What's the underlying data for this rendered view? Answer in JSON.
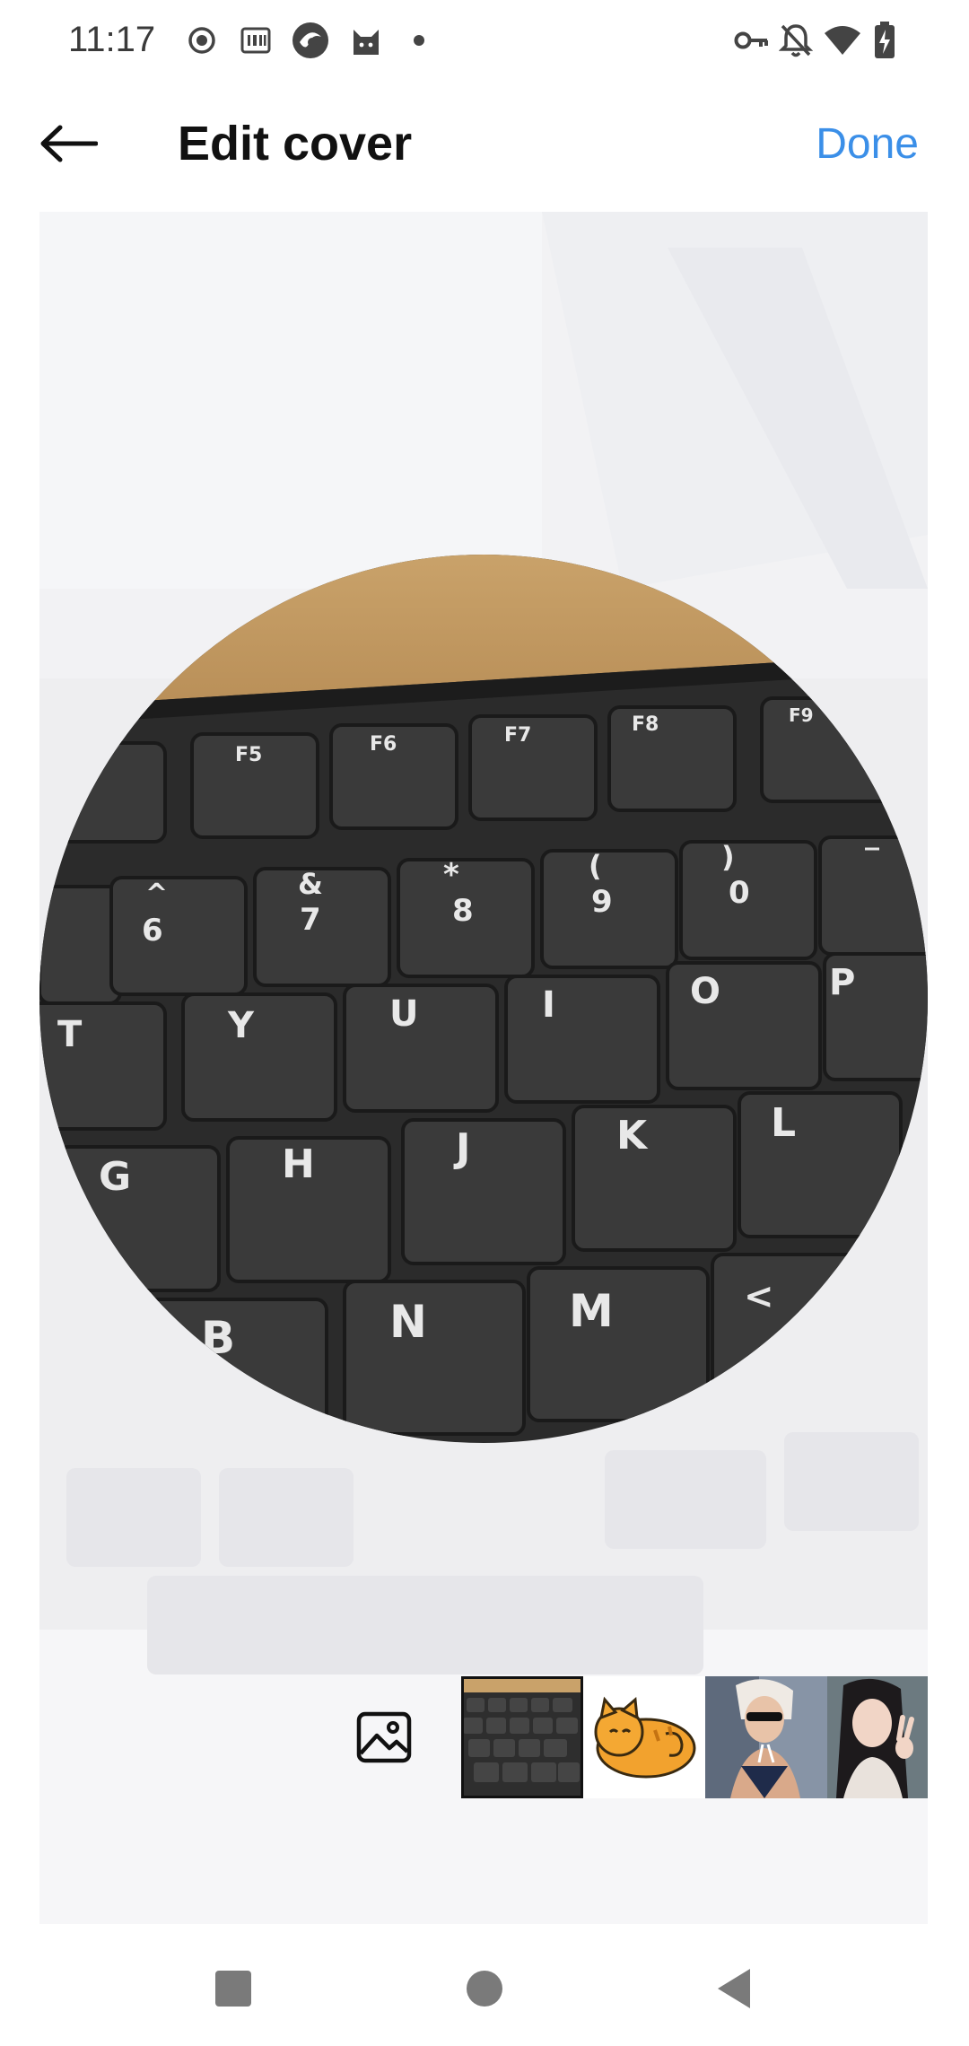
{
  "status_bar": {
    "time": "11:17",
    "left_icons": [
      "record-icon",
      "iqiyi-icon",
      "browser-icon",
      "cat-app-icon",
      "dot-icon"
    ],
    "right_icons": [
      "key-icon",
      "bell-off-icon",
      "wifi-icon",
      "battery-charging-icon"
    ]
  },
  "header": {
    "title": "Edit cover",
    "done_label": "Done",
    "back_icon": "arrow-left-icon"
  },
  "editor": {
    "crop_shape": "circle",
    "image_subject": "keyboard"
  },
  "thumbnails": {
    "gallery_icon": "image-icon",
    "items": [
      {
        "name": "thumb-keyboard",
        "selected": true
      },
      {
        "name": "thumb-cat-sticker",
        "selected": false
      },
      {
        "name": "thumb-woman-sunglasses",
        "selected": false
      },
      {
        "name": "thumb-woman-peace-sign",
        "selected": false
      }
    ]
  },
  "colors": {
    "accent": "#3b8fe8",
    "editor_bg": "#f1f1f3"
  },
  "nav": {
    "icons": [
      "recent-apps-icon",
      "home-icon",
      "back-icon"
    ]
  }
}
